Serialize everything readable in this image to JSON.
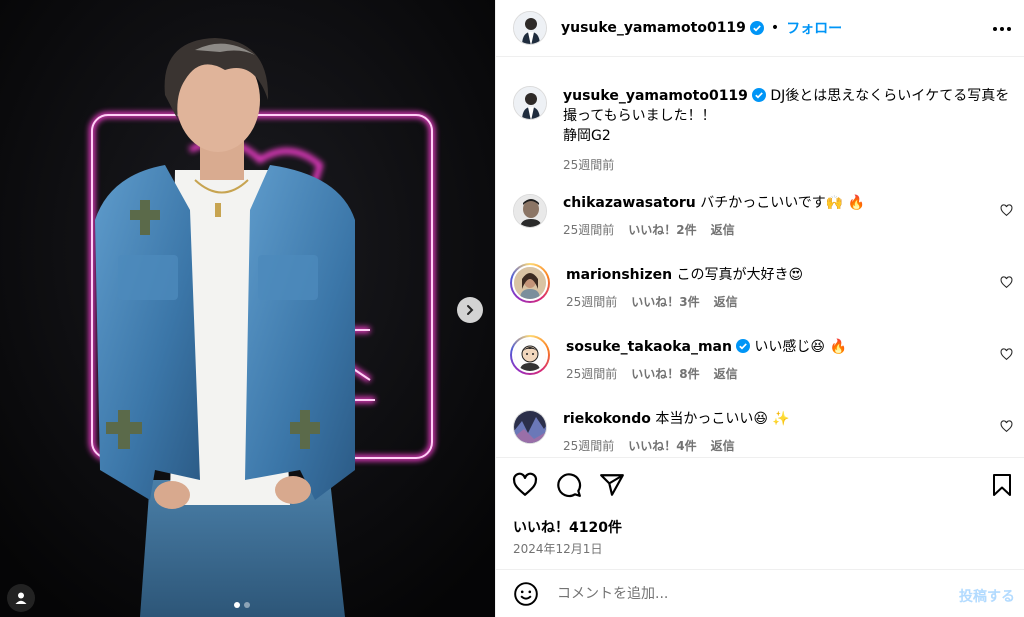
{
  "post": {
    "username": "yusuke_yamamoto0119",
    "separator": "•",
    "follow_label": "フォロー",
    "more_icon": "more-horizontal-icon"
  },
  "caption": {
    "username": "yusuke_yamamoto0119",
    "text": "DJ後とは思えなくらいイケてる写真を撮ってもらいました！！",
    "line2": "静岡G2",
    "time": "25週間前"
  },
  "comments": [
    {
      "username": "chikazawasatoru",
      "text": "バチかっこいいです🙌 🔥",
      "time": "25週間前",
      "likes": "いいね！2件",
      "reply": "返信"
    },
    {
      "username": "marionshizen",
      "text": "この写真が大好き😍",
      "time": "25週間前",
      "likes": "いいね！3件",
      "reply": "返信"
    },
    {
      "username": "sosuke_takaoka_man",
      "text": "いい感じ😆 🔥",
      "time": "25週間前",
      "likes": "いいね！8件",
      "reply": "返信"
    },
    {
      "username": "riekokondo",
      "text": "本当かっこいい😆 ✨",
      "time": "25週間前",
      "likes": "いいね！4件",
      "reply": "返信"
    }
  ],
  "summary": {
    "likes": "いいね！4120件",
    "date": "2024年12月1日"
  },
  "compose": {
    "placeholder": "コメントを追加...",
    "post_label": "投稿する"
  },
  "carousel": {
    "slide_count": 2,
    "current_slide": 1
  },
  "colors": {
    "accent": "#0095f6",
    "muted": "#737373",
    "neon_pink": "#ff3fd6"
  }
}
